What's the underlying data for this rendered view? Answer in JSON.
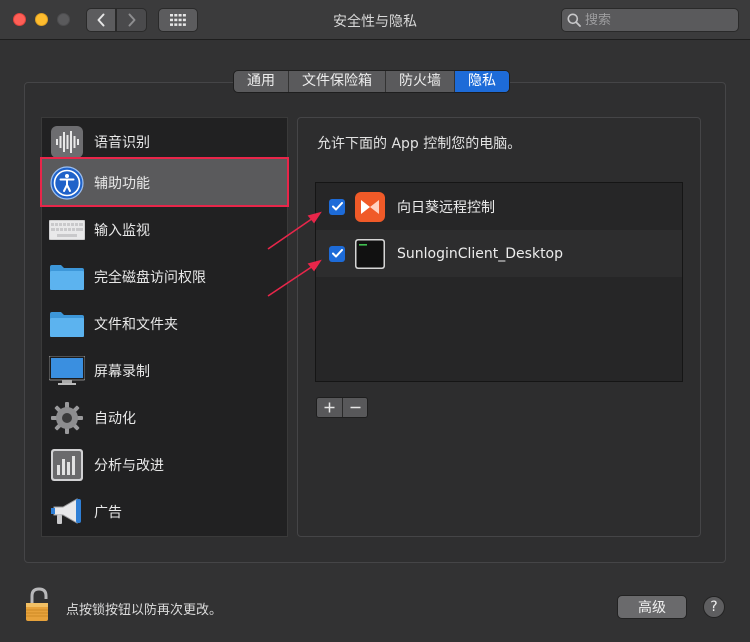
{
  "window": {
    "title": "安全性与隐私"
  },
  "search": {
    "placeholder": "搜索"
  },
  "tabs": [
    {
      "label": "通用",
      "active": false
    },
    {
      "label": "文件保险箱",
      "active": false
    },
    {
      "label": "防火墙",
      "active": false
    },
    {
      "label": "隐私",
      "active": true
    }
  ],
  "categories": [
    {
      "label": "语音识别",
      "icon": "waveform-icon"
    },
    {
      "label": "辅助功能",
      "icon": "accessibility-icon",
      "selected": true
    },
    {
      "label": "输入监视",
      "icon": "keyboard-icon"
    },
    {
      "label": "完全磁盘访问权限",
      "icon": "folder-icon"
    },
    {
      "label": "文件和文件夹",
      "icon": "folder-icon"
    },
    {
      "label": "屏幕录制",
      "icon": "display-icon"
    },
    {
      "label": "自动化",
      "icon": "gear-icon"
    },
    {
      "label": "分析与改进",
      "icon": "chart-icon"
    },
    {
      "label": "广告",
      "icon": "megaphone-icon"
    }
  ],
  "panel": {
    "description": "允许下面的 App 控制您的电脑。",
    "apps": [
      {
        "name": "向日葵远程控制",
        "checked": true,
        "icon": "sunlogin-icon"
      },
      {
        "name": "SunloginClient_Desktop",
        "checked": true,
        "icon": "terminal-icon"
      }
    ]
  },
  "footer": {
    "lock_text": "点按锁按钮以防再次更改。",
    "advanced_label": "高级",
    "help_label": "?"
  },
  "colors": {
    "accent": "#1d6bd8",
    "highlight": "#e8264a",
    "sunlogin": "#f05a28"
  }
}
